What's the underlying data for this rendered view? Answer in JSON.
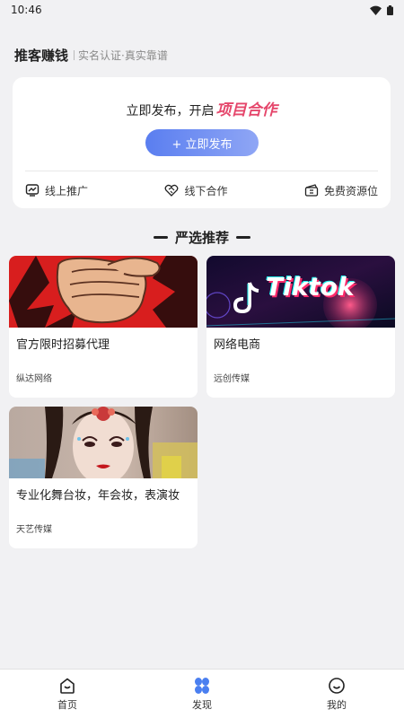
{
  "status_bar": {
    "time": "10:46"
  },
  "header": {
    "brand": "推客赚钱",
    "slogan": "实名认证·真实靠谱"
  },
  "publish_card": {
    "line_prefix": "立即发布，开启",
    "line_highlight": "项目合作",
    "button_label": "+ 立即发布",
    "tabs": [
      {
        "label": "线上推广",
        "icon": "online-promo-icon"
      },
      {
        "label": "线下合作",
        "icon": "handshake-icon"
      },
      {
        "label": "免费资源位",
        "icon": "ticket-icon"
      }
    ]
  },
  "section": {
    "title": "严选推荐"
  },
  "recommendations": [
    {
      "title": "官方限时招募代理",
      "company": "纵达网络",
      "image": "pointing-fist-image"
    },
    {
      "title": "网络电商",
      "company": "远创传媒",
      "image": "tiktok-banner-image",
      "image_text": "Tiktok"
    },
    {
      "title": "专业化舞台妆，年会妆，表演妆",
      "company": "天艺传媒",
      "image": "stage-makeup-image"
    }
  ],
  "bottom_nav": {
    "items": [
      {
        "label": "首页",
        "icon": "home-icon",
        "active": false
      },
      {
        "label": "发现",
        "icon": "discover-icon",
        "active": true
      },
      {
        "label": "我的",
        "icon": "profile-icon",
        "active": false
      }
    ]
  },
  "colors": {
    "accent": "#5a7ef0",
    "highlight": "#e5466b",
    "background": "#f1f1f3"
  }
}
